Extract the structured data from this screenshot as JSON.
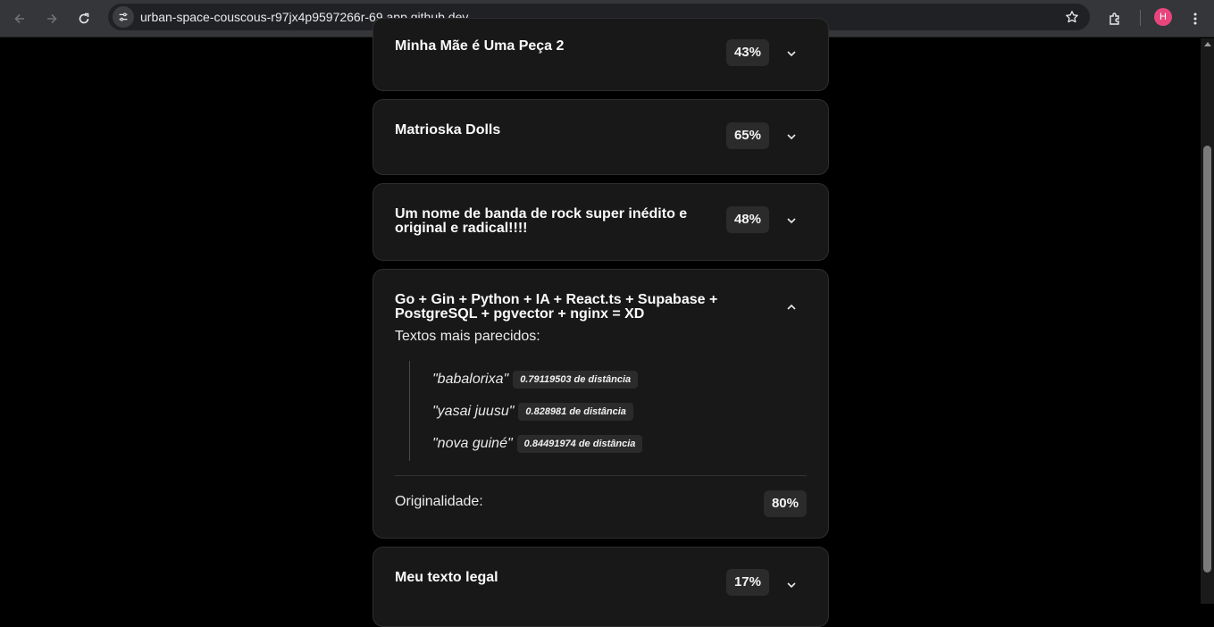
{
  "browser": {
    "url": "urban-space-couscous-r97jx4p9597266r-69.app.github.dev",
    "profile_initial": "H",
    "profile_color": "#e8457c"
  },
  "cards": [
    {
      "title": "Minha Mãe é Uma Peça 2",
      "percent": "43%"
    },
    {
      "title": "Matrioska Dolls",
      "percent": "65%"
    },
    {
      "title": "Um nome de banda de rock super inédito e original e radical!!!!",
      "percent": "48%"
    },
    {
      "title": "Go + Gin + Python + IA + React.ts + Supabase + PostgreSQL + pgvector + nginx = XD",
      "expanded": true,
      "similar_label": "Textos mais parecidos:",
      "similar": [
        {
          "text": "\"babalorixa\"",
          "distance": "0.79119503 de distância"
        },
        {
          "text": "\"yasai juusu\"",
          "distance": "0.828981 de distância"
        },
        {
          "text": "\"nova guiné\"",
          "distance": "0.84491974 de distância"
        }
      ],
      "originality_label": "Originalidade:",
      "originality": "80%"
    },
    {
      "title": "Meu texto legal",
      "percent": "17%"
    }
  ]
}
